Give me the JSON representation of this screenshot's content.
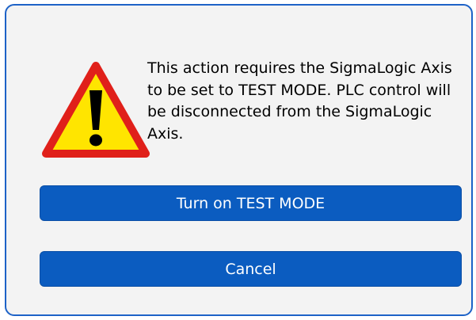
{
  "dialog": {
    "message": "This action requires the SigmaLogic Axis to be set to TEST MODE. PLC control will be disconnected from the SigmaLogic Axis.",
    "icon": "warning-icon",
    "buttons": {
      "confirm_label": "Turn on TEST MODE",
      "cancel_label": "Cancel"
    }
  },
  "colors": {
    "accent": "#0b5cc0",
    "border": "#1d62c7",
    "dialog_bg": "#f3f3f3",
    "warning_fill": "#ffe500",
    "warning_edge": "#e0201a"
  }
}
